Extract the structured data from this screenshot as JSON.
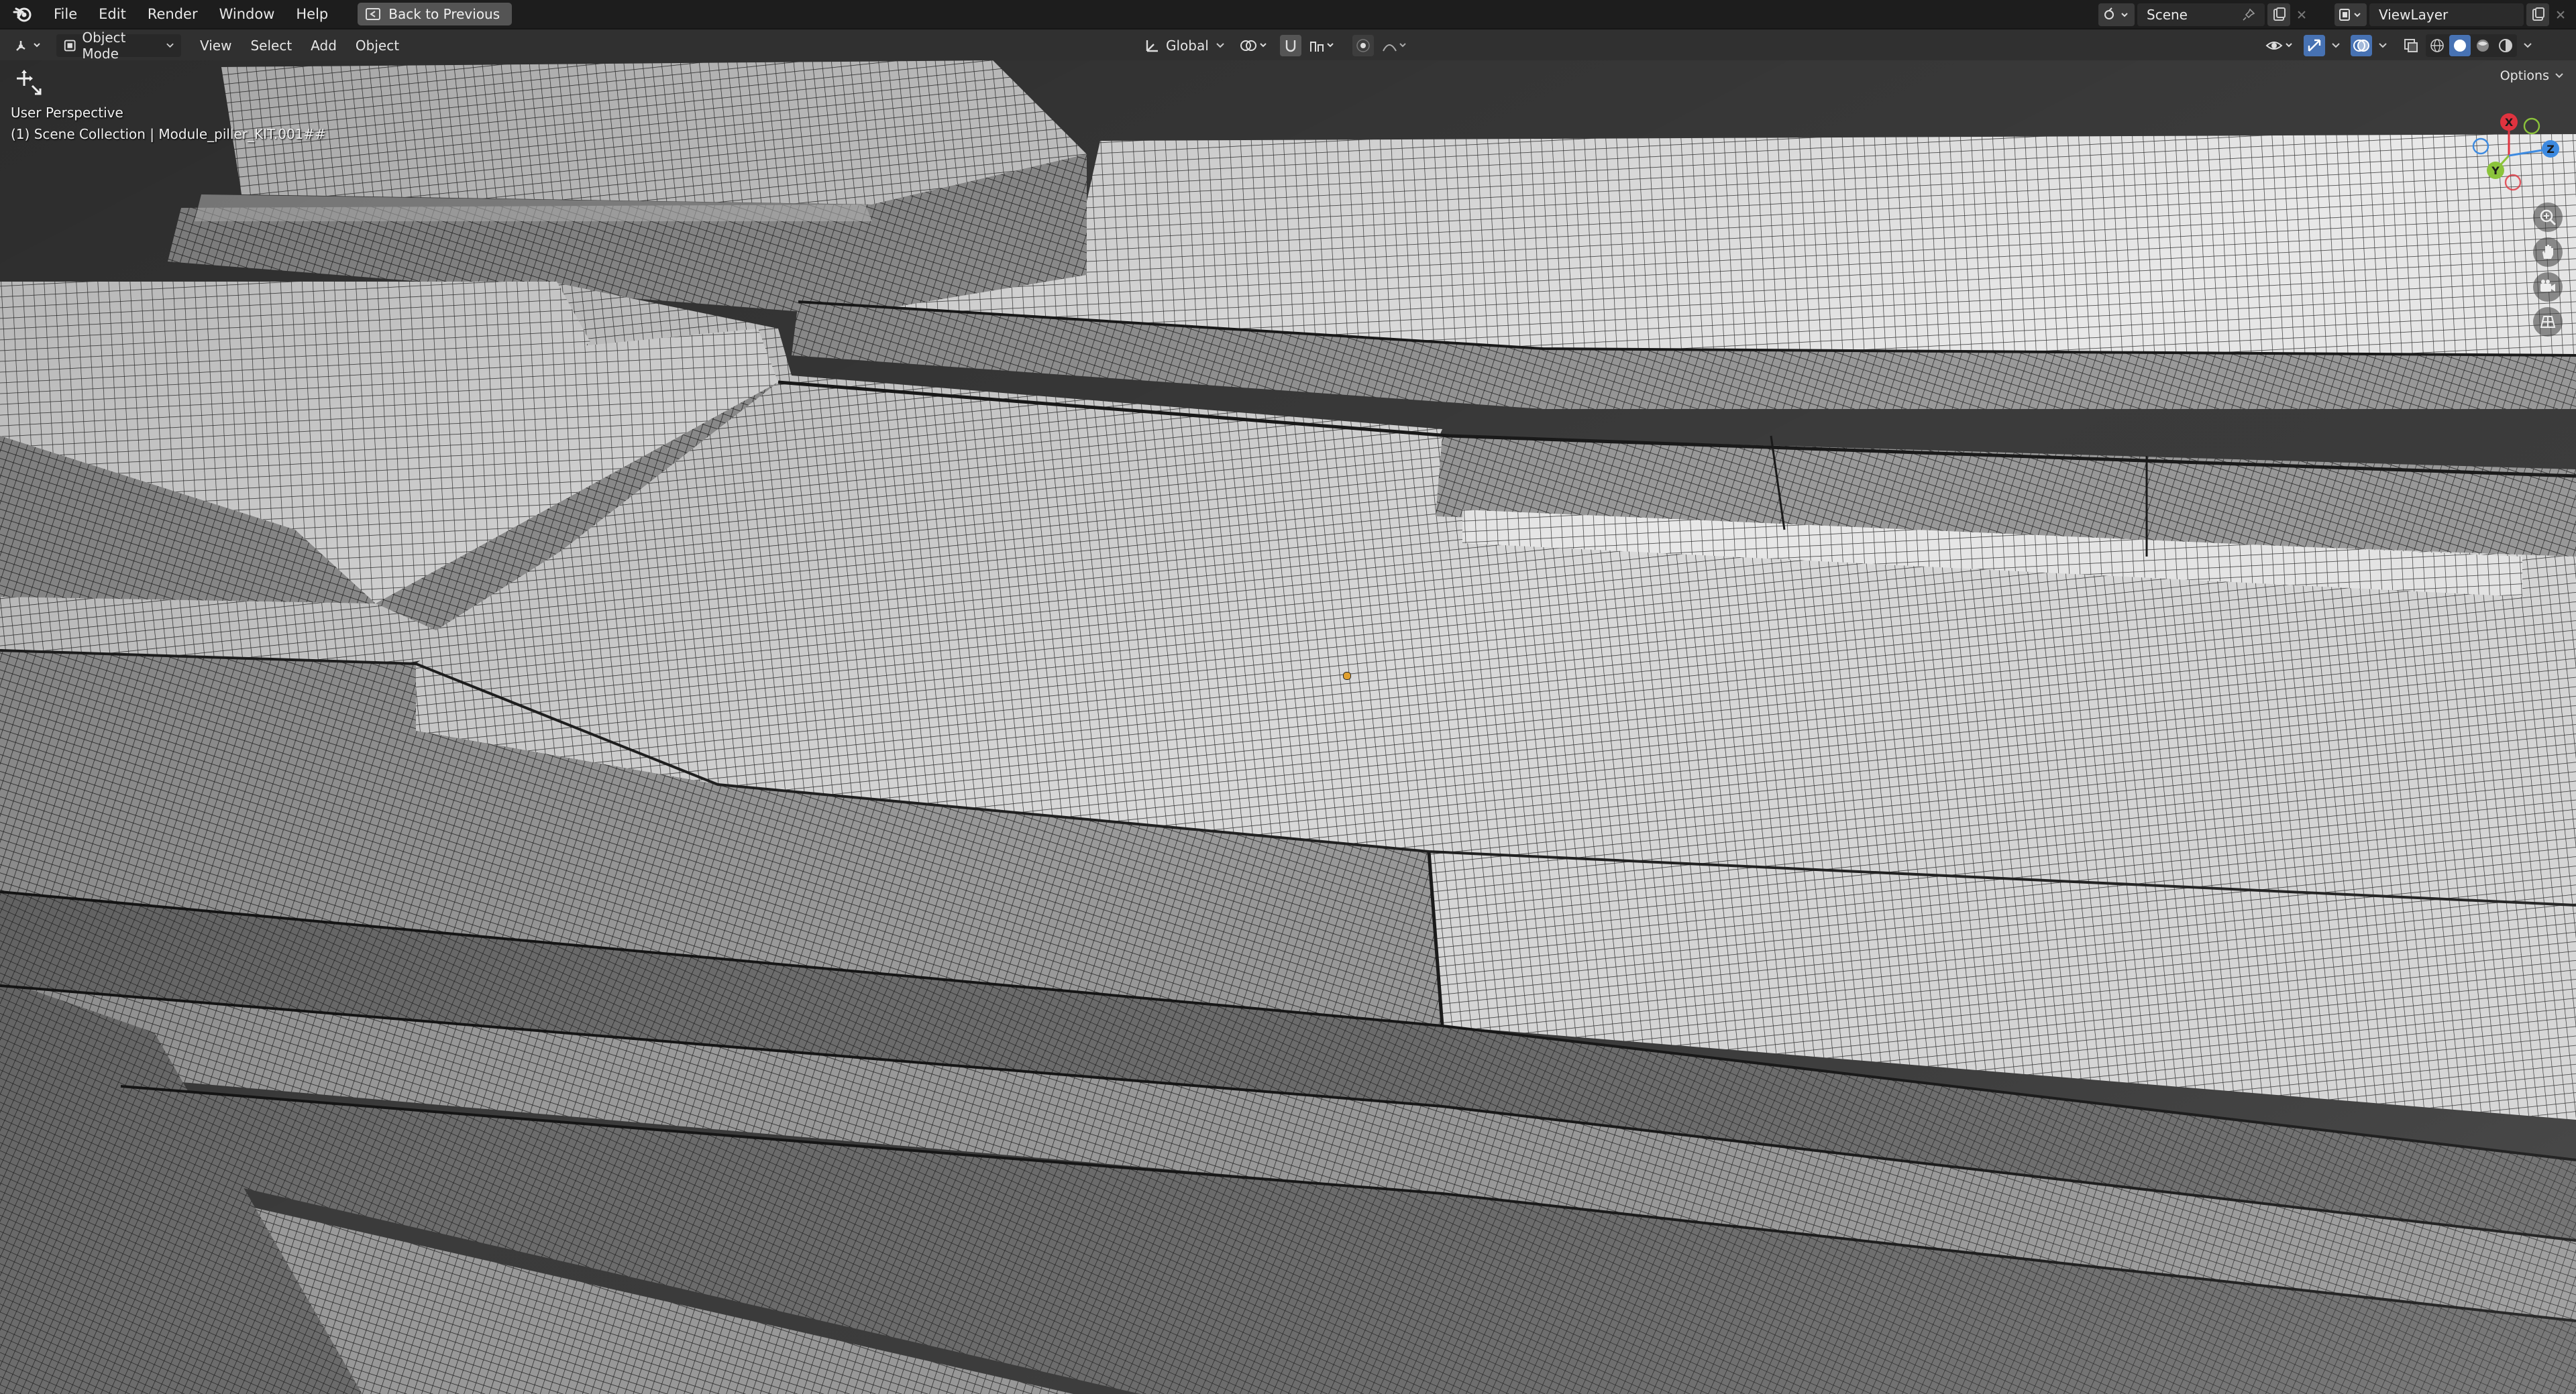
{
  "topbar": {
    "menu": [
      "File",
      "Edit",
      "Render",
      "Window",
      "Help"
    ],
    "back_button": "Back to Previous",
    "scene_name": "Scene",
    "view_layer": "ViewLayer"
  },
  "header": {
    "mode": "Object Mode",
    "menus": [
      "View",
      "Select",
      "Add",
      "Object"
    ],
    "transform_orientation": "Global",
    "options_label": "Options"
  },
  "viewport": {
    "perspective": "User Perspective",
    "collection_info": "(1) Scene Collection | Module_piller_KIT.001##",
    "gizmo_axes": [
      "X",
      "Y",
      "Z"
    ]
  },
  "colors": {
    "accent": "#4772b3",
    "axis_x": "#e0333f",
    "axis_y": "#8bc33b",
    "axis_z": "#3d8ae0",
    "origin": "#e0a030"
  },
  "icons": {
    "logo": "blender-logo-icon",
    "back": "back-to-previous-icon",
    "scene": "scene-icon",
    "pin": "pin-icon",
    "new": "new-scene-icon",
    "close": "close-icon",
    "view_layer": "view-layer-icon",
    "editor_type": "editor-type-icon",
    "object_mode": "object-mode-icon",
    "transform_orientation": "transform-orientation-icon",
    "pivot": "pivot-point-icon",
    "snap": "snap-icon",
    "proportional": "proportional-editing-icon",
    "visibility": "object-visibility-icon",
    "gizmo": "gizmo-toggle-icon",
    "overlays": "overlays-icon",
    "xray": "xray-toggle-icon",
    "shading": "viewport-shading-icon",
    "zoom": "zoom-icon",
    "pan": "pan-hand-icon",
    "camera": "camera-view-icon",
    "ortho": "perspective-toggle-icon",
    "tool": "transform-tool-icon"
  }
}
